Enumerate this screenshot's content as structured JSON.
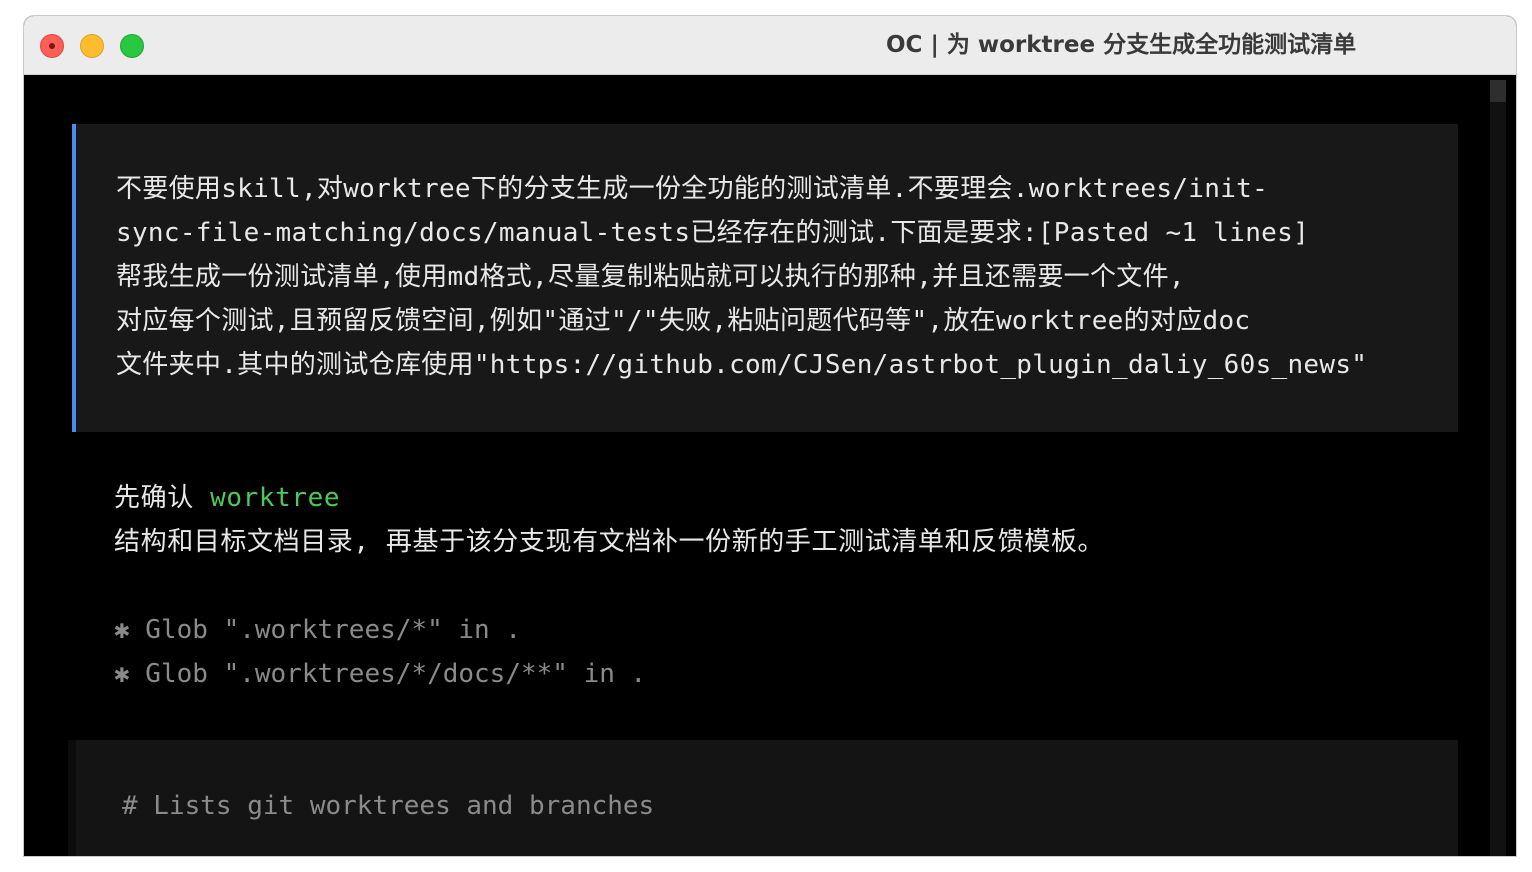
{
  "window": {
    "title": "OC | 为 worktree 分支生成全功能测试清单"
  },
  "user_message": {
    "lines": [
      "不要使用skill,对worktree下的分支生成一份全功能的测试清单.不要理会.worktrees/init-",
      "sync-file-matching/docs/manual-tests已经存在的测试.下面是要求:[Pasted ~1 lines]",
      "帮我生成一份测试清单,使用md格式,尽量复制粘贴就可以执行的那种,并且还需要一个文件,",
      "对应每个测试,且预留反馈空间,例如\"通过\"/\"失败,粘贴问题代码等\",放在worktree的对应doc",
      "文件夹中.其中的测试仓库使用\"https://github.com/CJSen/astrbot_plugin_daliy_60s_news\""
    ]
  },
  "assistant_reply": {
    "line1_prefix": "先确认 ",
    "line1_highlight": "worktree",
    "line2": "结构和目标文档目录, 再基于该分支现有文档补一份新的手工测试清单和反馈模板。"
  },
  "tool_calls": [
    "✱ Glob \".worktrees/*\" in .",
    "✱ Glob \".worktrees/*/docs/**\" in ."
  ],
  "code_block": {
    "comment": "# Lists git worktrees and branches"
  },
  "colors": {
    "accent_bar": "#4a8cf0",
    "highlight": "#4cc95a",
    "background": "#000000"
  }
}
